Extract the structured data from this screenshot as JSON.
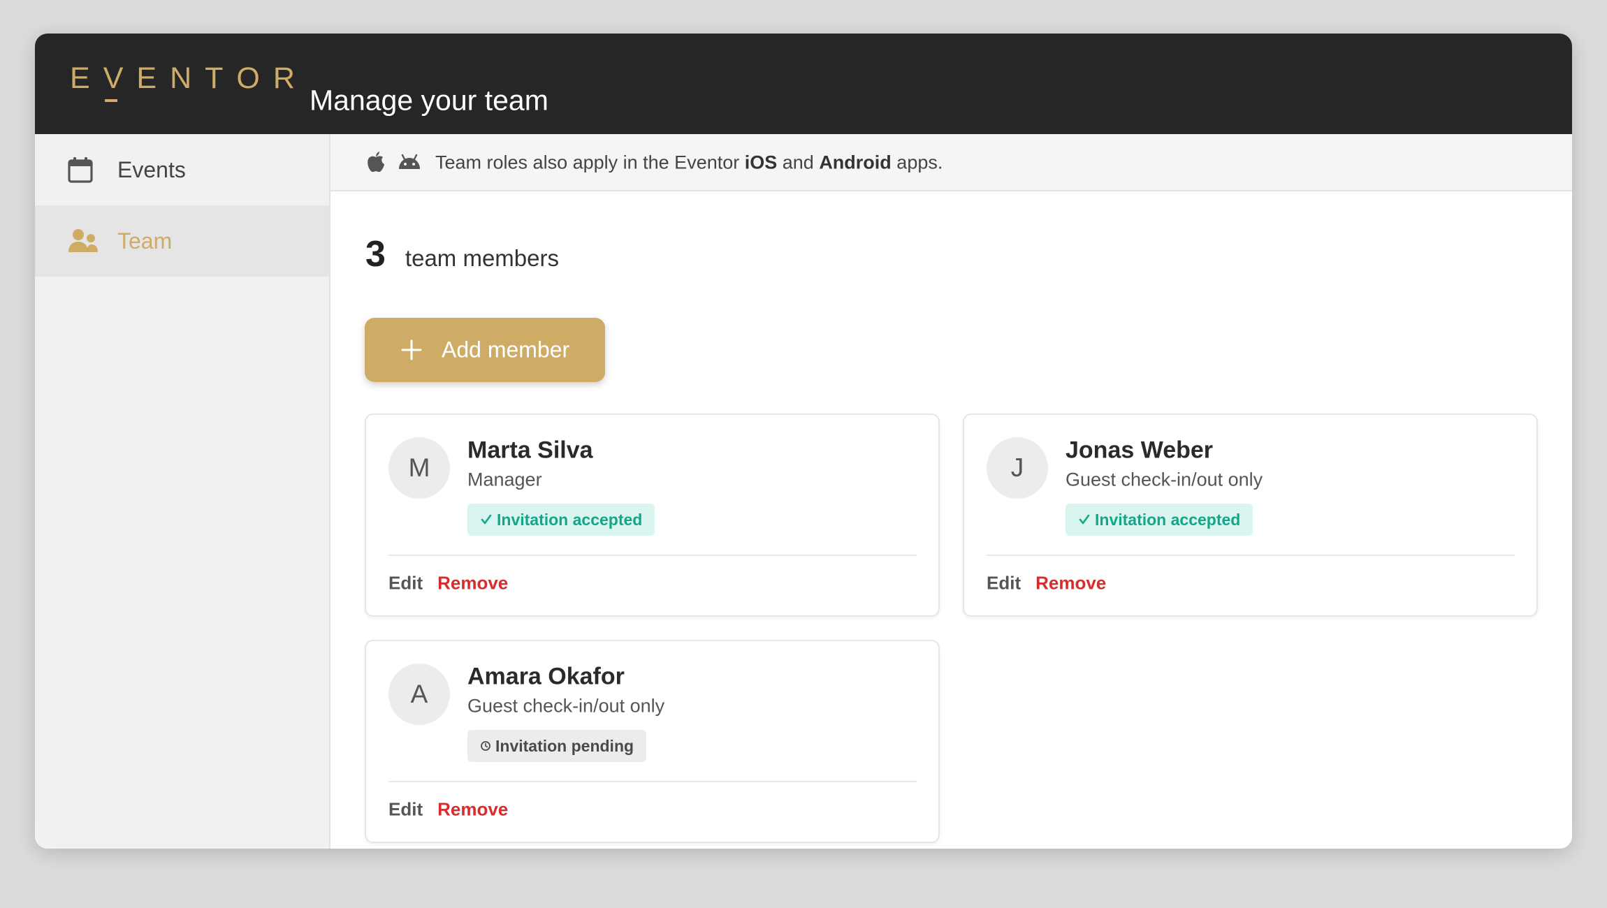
{
  "app": {
    "logo_letters": [
      "E",
      "V",
      "E",
      "N",
      "T",
      "O",
      "R"
    ],
    "page_title": "Manage your team",
    "brand_color": "#cfac66",
    "header_color": "#262626"
  },
  "sidebar": {
    "items": [
      {
        "label": "Events",
        "icon": "calendar-icon",
        "active": false
      },
      {
        "label": "Team",
        "icon": "people-icon",
        "active": true
      }
    ]
  },
  "notice": {
    "icons": [
      "apple-icon",
      "android-icon"
    ],
    "prefix": "Team roles also apply in the Eventor ",
    "ios": "iOS",
    "middle": " and ",
    "android": "Android",
    "suffix": " apps."
  },
  "team": {
    "count": "3",
    "count_label": "team members",
    "add_label": "Add member",
    "members": [
      {
        "initial": "M",
        "name": "Marta Silva",
        "role": "Manager",
        "status": "Invitation accepted",
        "status_type": "accepted",
        "edit": "Edit",
        "remove": "Remove"
      },
      {
        "initial": "J",
        "name": "Jonas Weber",
        "role": "Guest check-in/out only",
        "status": "Invitation accepted",
        "status_type": "accepted",
        "edit": "Edit",
        "remove": "Remove"
      },
      {
        "initial": "A",
        "name": "Amara Okafor",
        "role": "Guest check-in/out only",
        "status": "Invitation pending",
        "status_type": "pending",
        "edit": "Edit",
        "remove": "Remove"
      }
    ]
  },
  "colors": {
    "accepted_bg": "#d9f5ef",
    "accepted_text": "#13a689",
    "pending_bg": "#ececec",
    "remove": "#d32f2f"
  }
}
